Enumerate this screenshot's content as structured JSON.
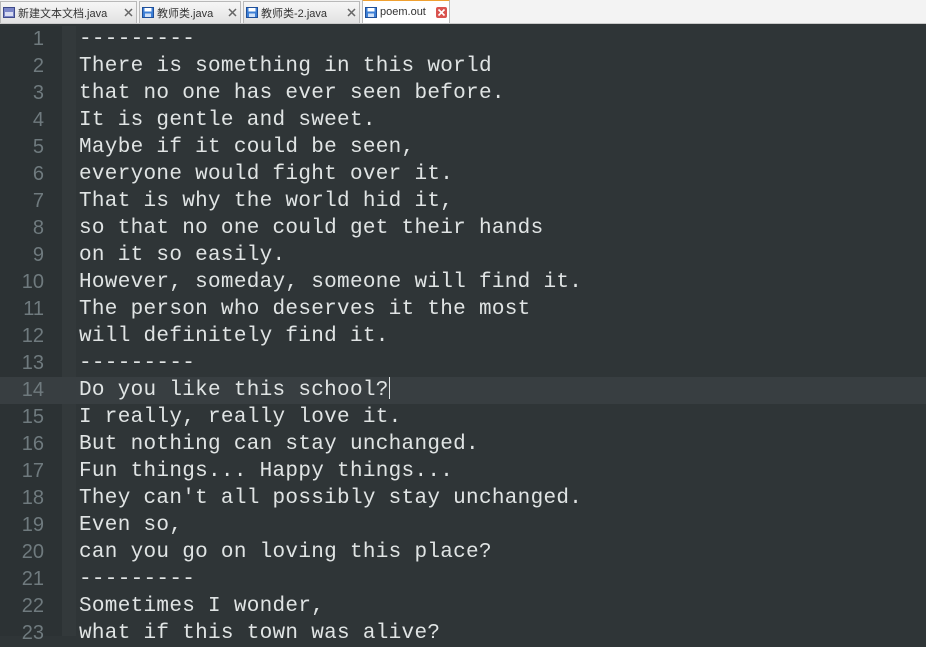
{
  "tabs": [
    {
      "label": "新建文本文档.java",
      "icon": "java-file-icon",
      "active": false
    },
    {
      "label": "教师类.java",
      "icon": "save-icon",
      "active": false
    },
    {
      "label": "教师类-2.java",
      "icon": "save-icon",
      "active": false
    },
    {
      "label": "poem.out",
      "icon": "save-icon",
      "active": true
    }
  ],
  "editor": {
    "lines": [
      {
        "num": "1",
        "text": "---------"
      },
      {
        "num": "2",
        "text": "There is something in this world"
      },
      {
        "num": "3",
        "text": "that no one has ever seen before."
      },
      {
        "num": "4",
        "text": "It is gentle and sweet."
      },
      {
        "num": "5",
        "text": "Maybe if it could be seen,"
      },
      {
        "num": "6",
        "text": "everyone would fight over it."
      },
      {
        "num": "7",
        "text": "That is why the world hid it,"
      },
      {
        "num": "8",
        "text": "so that no one could get their hands"
      },
      {
        "num": "9",
        "text": "on it so easily."
      },
      {
        "num": "10",
        "text": "However, someday, someone will find it."
      },
      {
        "num": "11",
        "text": "The person who deserves it the most"
      },
      {
        "num": "12",
        "text": "will definitely find it."
      },
      {
        "num": "13",
        "text": "---------"
      },
      {
        "num": "14",
        "text": "Do you like this school?"
      },
      {
        "num": "15",
        "text": "I really, really love it."
      },
      {
        "num": "16",
        "text": "But nothing can stay unchanged."
      },
      {
        "num": "17",
        "text": "Fun things... Happy things..."
      },
      {
        "num": "18",
        "text": "They can't all possibly stay unchanged."
      },
      {
        "num": "19",
        "text": "Even so,"
      },
      {
        "num": "20",
        "text": "can you go on loving this place?"
      },
      {
        "num": "21",
        "text": "---------"
      },
      {
        "num": "22",
        "text": "Sometimes I wonder,"
      },
      {
        "num": "23",
        "text": "what if this town was alive?"
      }
    ],
    "current_line": 14
  },
  "colors": {
    "background": "#2f3537",
    "gutter": "#2c3234",
    "text": "#e0e4e4",
    "line_number": "#6f7a7e",
    "current_line": "#383e41",
    "active_tab_accent": "#f0a030",
    "close_active": "#d9534f"
  }
}
